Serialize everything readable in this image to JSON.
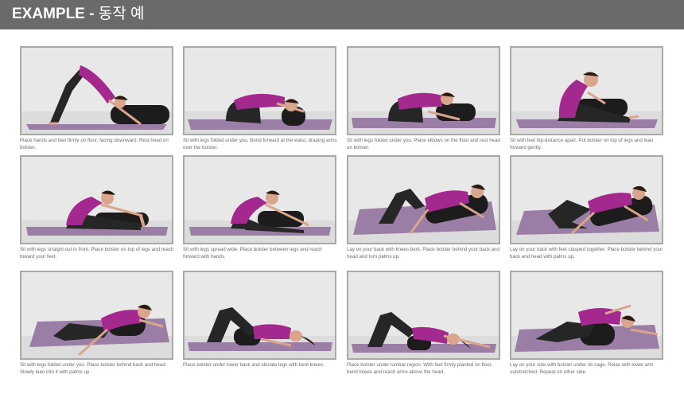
{
  "header": {
    "title_bold": "EXAMPLE -",
    "title_rest": "동작 예"
  },
  "colors": {
    "header_bg": "#6a6a6a",
    "shirt": "#a4298e",
    "mat": "#9a7ea5",
    "pants": "#262626",
    "bolster": "#1c1c1c"
  },
  "poses": [
    {
      "icon": "downward-dog-pose",
      "caption": "Place hands and feet firmly on floor, facing downward. Rest head on bolster."
    },
    {
      "icon": "child-pose-over-bolster",
      "caption": "Sit with legs folded under you. Bend forward at the waist, draping arms over the bolster."
    },
    {
      "icon": "child-pose-elbows-down",
      "caption": "Sit with legs folded under you. Place elbows on the floor and rest head on bolster."
    },
    {
      "icon": "seated-forward-bend-bolster-on-legs",
      "caption": "Sit with feet hip-distance apart. Put bolster on top of legs and lean forward gently."
    },
    {
      "icon": "seated-forward-fold-reach-feet",
      "caption": "Sit with legs straight out in front. Place bolster on top of legs and reach toward your feet."
    },
    {
      "icon": "wide-leg-forward-fold",
      "caption": "Sit with legs spread wide. Place bolster between legs and reach forward with hands."
    },
    {
      "icon": "supported-backbend-knees-bent",
      "caption": "Lay on your back with knees bent. Place bolster behind your back and head and turn palms up."
    },
    {
      "icon": "supported-bound-angle",
      "caption": "Lay on your back with feet clasped together. Place bolster behind your back and head with palms up."
    },
    {
      "icon": "supported-hero-recline",
      "caption": "Sit with legs folded under you. Place bolster behind back and head.  Slowly lean into it with palms up."
    },
    {
      "icon": "bolster-under-lower-back",
      "caption": "Place bolster under lower back and elevate legs with bent knees."
    },
    {
      "icon": "supported-bridge",
      "caption": "Place bolster under lumbar region. With feet firmly planted on floor, bend knees and reach arms above the head."
    },
    {
      "icon": "side-lying-bolster",
      "caption": "Lay on your side with bolster under rib cage. Relax with lower arm outstretched. Repeat on other side."
    }
  ]
}
